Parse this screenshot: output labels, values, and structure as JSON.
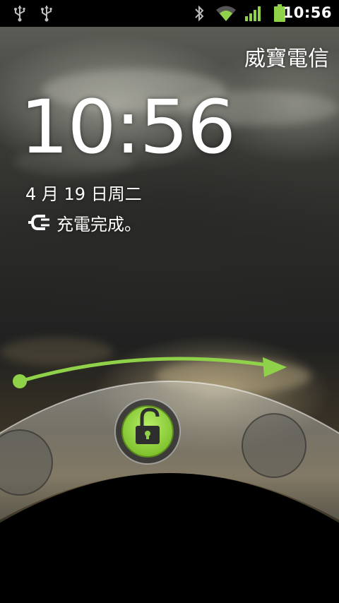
{
  "statusbar": {
    "left_icons": [
      "usb-icon",
      "usb-icon"
    ],
    "right_icons": [
      "bluetooth-icon",
      "wifi-icon",
      "signal-icon",
      "battery-icon"
    ],
    "time": "10:56"
  },
  "lockscreen": {
    "carrier": "威寶電信",
    "clock": "10:56",
    "date": "4 月 19 日周二",
    "charge_status": "充電完成。",
    "unlock_icon": "unlock-padlock-icon",
    "accent_color": "#8fd24a"
  }
}
